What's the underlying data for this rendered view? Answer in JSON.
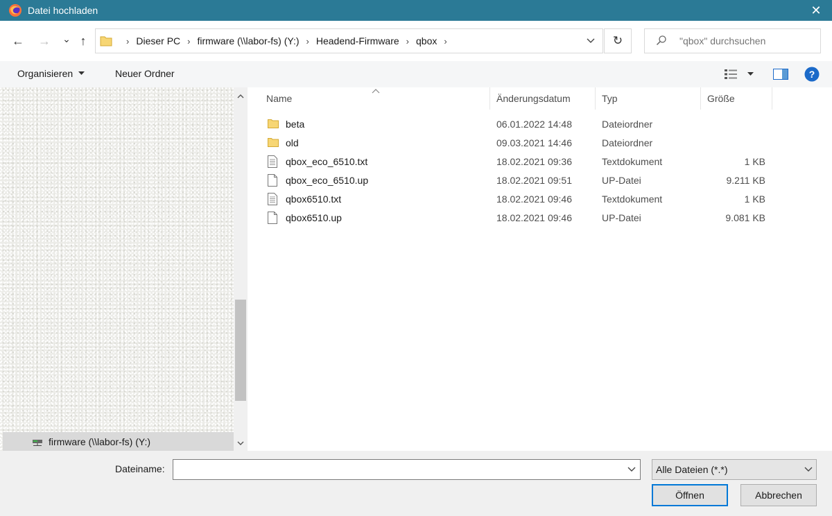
{
  "window": {
    "title": "Datei hochladen",
    "close_symbol": "✕"
  },
  "nav": {
    "back_symbol": "←",
    "forward_symbol": "→",
    "recent_symbol": "⌄",
    "up_symbol": "↑",
    "breadcrumbs": [
      "Dieser PC",
      "firmware (\\\\labor-fs) (Y:)",
      "Headend-Firmware",
      "qbox"
    ],
    "refresh_symbol": "↻",
    "search_placeholder": "\"qbox\" durchsuchen"
  },
  "toolbar": {
    "organize_label": "Organisieren",
    "new_folder_label": "Neuer Ordner"
  },
  "sidebar": {
    "selected_drive": "firmware (\\\\labor-fs) (Y:)"
  },
  "columns": {
    "name": "Name",
    "date": "Änderungsdatum",
    "type": "Typ",
    "size": "Größe"
  },
  "files": [
    {
      "name": "beta",
      "date": "06.01.2022 14:48",
      "type": "Dateiordner",
      "size": "",
      "icon": "folder-icon"
    },
    {
      "name": "old",
      "date": "09.03.2021 14:46",
      "type": "Dateiordner",
      "size": "",
      "icon": "folder-icon"
    },
    {
      "name": "qbox_eco_6510.txt",
      "date": "18.02.2021 09:36",
      "type": "Textdokument",
      "size": "1 KB",
      "icon": "text-file-icon"
    },
    {
      "name": "qbox_eco_6510.up",
      "date": "18.02.2021 09:51",
      "type": "UP-Datei",
      "size": "9.211 KB",
      "icon": "file-icon"
    },
    {
      "name": "qbox6510.txt",
      "date": "18.02.2021 09:46",
      "type": "Textdokument",
      "size": "1 KB",
      "icon": "text-file-icon"
    },
    {
      "name": "qbox6510.up",
      "date": "18.02.2021 09:46",
      "type": "UP-Datei",
      "size": "9.081 KB",
      "icon": "file-icon"
    }
  ],
  "bottom": {
    "filename_label": "Dateiname:",
    "filename_value": "",
    "filter_value": "Alle Dateien (*.*)",
    "open_label": "Öffnen",
    "cancel_label": "Abbrechen"
  },
  "colors": {
    "titlebar": "#2b7a96",
    "folder": "#f7d674",
    "help": "#1b6ac9",
    "primary_border": "#0078d7"
  }
}
